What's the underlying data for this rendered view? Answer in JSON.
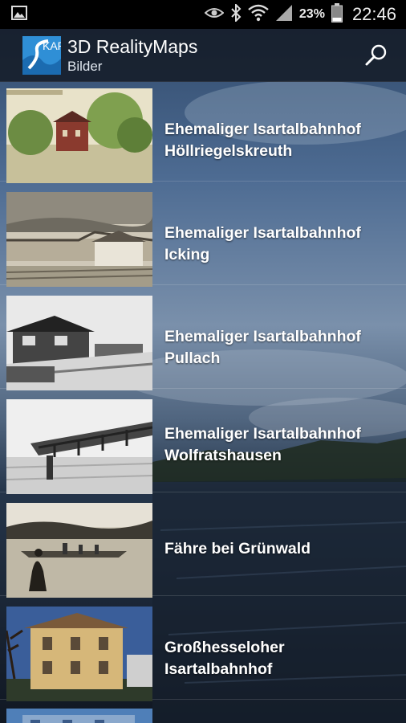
{
  "status_bar": {
    "icons": [
      "gallery-icon",
      "eye-icon",
      "bluetooth-icon",
      "wifi-icon",
      "signal-icon",
      "battery-icon"
    ],
    "battery_percent": "23%",
    "time": "22:46"
  },
  "action_bar": {
    "logo_text": "KAR",
    "title": "3D RealityMaps",
    "subtitle": "Bilder",
    "search_icon": "search-icon"
  },
  "items": [
    {
      "line1": "Ehemaliger Isartalbahnhof",
      "line2": "Höllriegelskreuth",
      "thumb_style": "color-postcard"
    },
    {
      "line1": "Ehemaliger Isartalbahnhof",
      "line2": "Icking",
      "thumb_style": "sepia-photo"
    },
    {
      "line1": "Ehemaliger Isartalbahnhof",
      "line2": "Pullach",
      "thumb_style": "bw-photo"
    },
    {
      "line1": "Ehemaliger Isartalbahnhof",
      "line2": "Wolfratshausen",
      "thumb_style": "bw-photo"
    },
    {
      "line1": "Fähre bei Grünwald",
      "line2": "",
      "thumb_style": "sepia-photo"
    },
    {
      "line1": "Großhesseloher",
      "line2": "Isartalbahnhof",
      "thumb_style": "color-photo"
    },
    {
      "line1": "",
      "line2": "",
      "thumb_style": "color-photo"
    }
  ],
  "colors": {
    "status_bar": "#000000",
    "action_bar": "#121822",
    "text": "#ffffff",
    "logo_blue": "#2f8fd6"
  }
}
